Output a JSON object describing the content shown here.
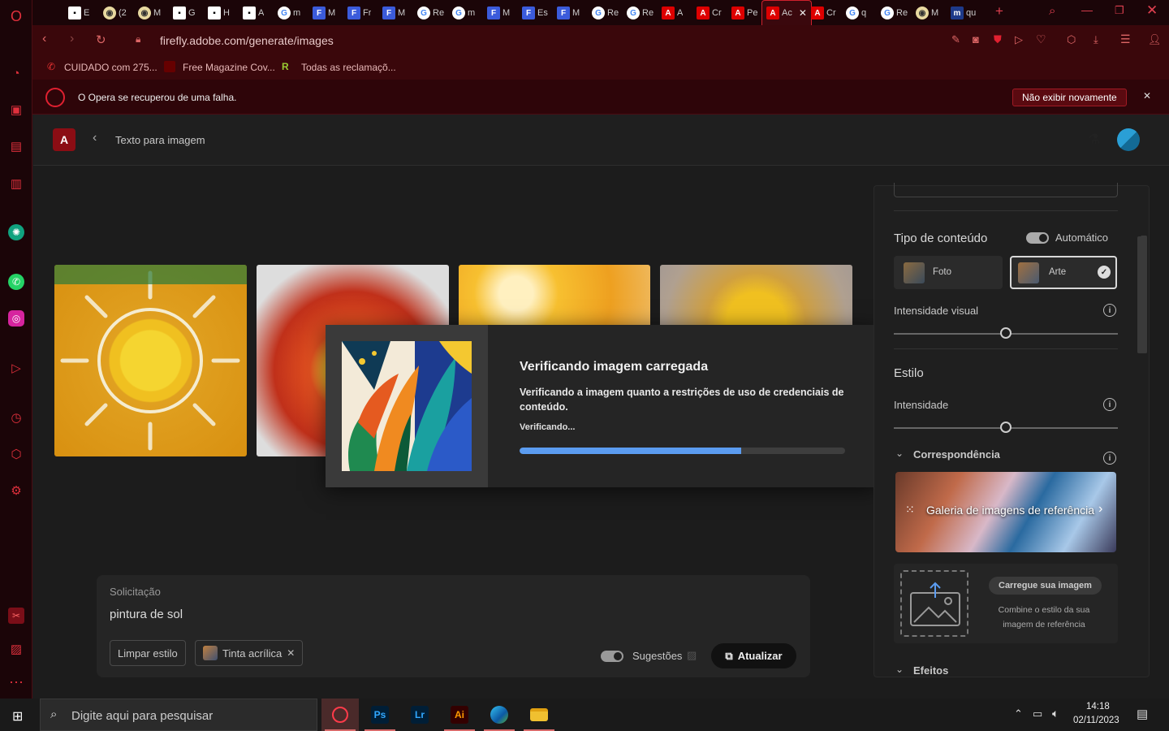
{
  "browser": {
    "tabs": [
      {
        "label": "E",
        "fav": "s",
        "icon": "▪"
      },
      {
        "label": "(2",
        "fav": "y",
        "icon": "◉"
      },
      {
        "label": "M",
        "fav": "y",
        "icon": "◉"
      },
      {
        "label": "G",
        "fav": "s",
        "icon": "▪"
      },
      {
        "label": "H",
        "fav": "s",
        "icon": "▪"
      },
      {
        "label": "A",
        "fav": "s",
        "icon": "▪"
      },
      {
        "label": "m",
        "fav": "g",
        "icon": "G"
      },
      {
        "label": "M",
        "fav": "f",
        "icon": "F"
      },
      {
        "label": "Fr",
        "fav": "f",
        "icon": "F"
      },
      {
        "label": "M",
        "fav": "f",
        "icon": "F"
      },
      {
        "label": "Re",
        "fav": "g",
        "icon": "G"
      },
      {
        "label": "m",
        "fav": "g",
        "icon": "G"
      },
      {
        "label": "M",
        "fav": "f",
        "icon": "F"
      },
      {
        "label": "Es",
        "fav": "f",
        "icon": "F"
      },
      {
        "label": "M",
        "fav": "f",
        "icon": "F"
      },
      {
        "label": "Re",
        "fav": "g",
        "icon": "G"
      },
      {
        "label": "Re",
        "fav": "g",
        "icon": "G"
      },
      {
        "label": "A",
        "fav": "a",
        "icon": "A"
      },
      {
        "label": "Cr",
        "fav": "a",
        "icon": "A"
      },
      {
        "label": "Pe",
        "fav": "a",
        "icon": "A"
      },
      {
        "label": "Ac",
        "fav": "a",
        "icon": "A",
        "active": true
      },
      {
        "label": "Cr",
        "fav": "a",
        "icon": "A"
      },
      {
        "label": "q",
        "fav": "g",
        "icon": "G"
      },
      {
        "label": "Re",
        "fav": "g",
        "icon": "G"
      },
      {
        "label": "M",
        "fav": "y",
        "icon": "◉"
      },
      {
        "label": "qu",
        "fav": "m",
        "icon": "m"
      }
    ],
    "address": "firefly.adobe.com/generate/images",
    "bookmarks": [
      "CUIDADO com 275...",
      "Free Magazine Cov...",
      "Todas as reclamaçõ..."
    ],
    "notice": {
      "text": "O Opera se recuperou de uma falha.",
      "button": "Não exibir novamente"
    }
  },
  "app": {
    "breadcrumb": "Texto para imagem",
    "dialog": {
      "title": "Verificando imagem carregada",
      "description": "Verificando a imagem quanto a restrições de uso de credenciais de conteúdo.",
      "status": "Verificando...",
      "progress": 0.68
    },
    "panel": {
      "content_type_label": "Tipo de conteúdo",
      "auto_label": "Automático",
      "photo_label": "Foto",
      "art_label": "Arte",
      "visual_intensity_label": "Intensidade visual",
      "visual_intensity_value": 0.5,
      "style_label": "Estilo",
      "intensity_label": "Intensidade",
      "intensity_value": 0.5,
      "match_label": "Correspondência",
      "gallery_label": "Galeria de imagens de referência",
      "upload_button": "Carregue sua imagem",
      "upload_hint": "Combine o estilo da sua imagem de referência",
      "effects_label": "Efeitos"
    },
    "prompt": {
      "label": "Solicitação",
      "value": "pintura de sol",
      "clear_style": "Limpar estilo",
      "style_chip": "Tinta acrílica",
      "suggestions": "Sugestões",
      "refresh": "Atualizar"
    }
  },
  "taskbar": {
    "search_placeholder": "Digite aqui para pesquisar",
    "time": "14:18",
    "date": "02/11/2023",
    "apps": [
      "Opera",
      "Ps",
      "Lr",
      "Ai",
      "Edge",
      "Explorer"
    ]
  }
}
